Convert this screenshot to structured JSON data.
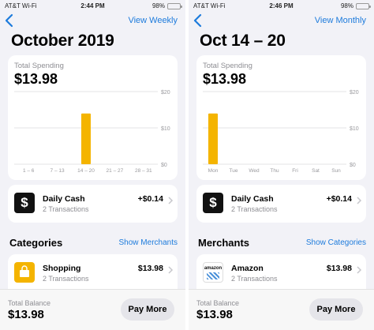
{
  "left": {
    "status": {
      "carrier": "AT&T Wi-Fi",
      "time": "2:44 PM",
      "battery": "98%",
      "battery_level": 0.98
    },
    "nav_action": "View Weekly",
    "period_title": "October 2019",
    "spending": {
      "label": "Total Spending",
      "amount": "$13.98"
    },
    "chart_data": {
      "type": "bar",
      "categories": [
        "1 – 6",
        "7 – 13",
        "14 – 20",
        "21 – 27",
        "28 – 31"
      ],
      "values": [
        0,
        0,
        13.98,
        0,
        0
      ],
      "ylim": [
        0,
        20
      ],
      "yticks": [
        "$20",
        "$10",
        "$0"
      ],
      "ytick_values": [
        20,
        10,
        0
      ],
      "grid": true,
      "bar_color": "#f4b400"
    },
    "daily_cash": {
      "title": "Daily Cash",
      "subtitle": "2 Transactions",
      "amount": "+$0.14",
      "icon": "$"
    },
    "section": {
      "title": "Categories",
      "link": "Show Merchants"
    },
    "item": {
      "title": "Shopping",
      "subtitle": "2 Transactions",
      "amount": "$13.98",
      "icon": "shopping-bag-icon"
    },
    "total": {
      "label": "Total Balance",
      "amount": "$13.98"
    },
    "pay_button": "Pay More"
  },
  "right": {
    "status": {
      "carrier": "AT&T Wi-Fi",
      "time": "2:46 PM",
      "battery": "98%",
      "battery_level": 0.98
    },
    "nav_action": "View Monthly",
    "period_title": "Oct 14 – 20",
    "spending": {
      "label": "Total Spending",
      "amount": "$13.98"
    },
    "chart_data": {
      "type": "bar",
      "categories": [
        "Mon",
        "Tue",
        "Wed",
        "Thu",
        "Fri",
        "Sat",
        "Sun"
      ],
      "values": [
        13.98,
        0,
        0,
        0,
        0,
        0,
        0
      ],
      "ylim": [
        0,
        20
      ],
      "yticks": [
        "$20",
        "$10",
        "$0"
      ],
      "ytick_values": [
        20,
        10,
        0
      ],
      "grid": true,
      "bar_color": "#f4b400"
    },
    "daily_cash": {
      "title": "Daily Cash",
      "subtitle": "2 Transactions",
      "amount": "+$0.14",
      "icon": "$"
    },
    "section": {
      "title": "Merchants",
      "link": "Show Categories"
    },
    "item": {
      "title": "Amazon",
      "subtitle": "2 Transactions",
      "amount": "$13.98",
      "icon": "amazon-logo-icon",
      "logo_text": "amazon"
    },
    "total": {
      "label": "Total Balance",
      "amount": "$13.98"
    },
    "pay_button": "Pay More"
  },
  "colors": {
    "accent": "#1d7bdc",
    "bar": "#f4b400",
    "battery": "#34c759"
  }
}
